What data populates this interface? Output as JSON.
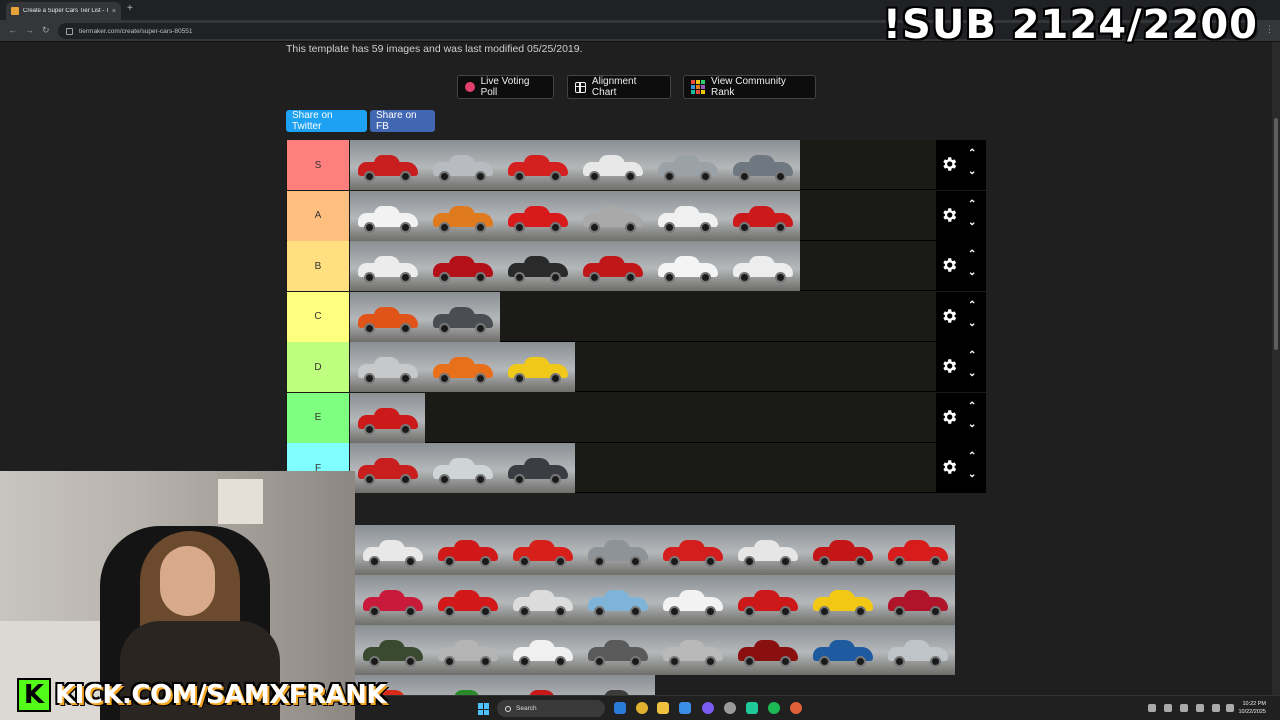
{
  "browser": {
    "tab_title": "Create a Super Cars Tier List - T",
    "tab_close": "×",
    "new_tab": "+",
    "url": "tiermaker.com/create/super-cars-80551"
  },
  "page": {
    "info_text": "This template has 59 images and was last modified 05/25/2019.",
    "buttons": {
      "live_poll": "Live Voting Poll",
      "alignment": "Alignment Chart",
      "community": "View Community Rank"
    },
    "share": {
      "twitter": "Share on Twitter",
      "facebook": "Share on FB"
    }
  },
  "tiers": [
    {
      "label": "S",
      "color": "#ff7f7f",
      "cars": [
        "#c81e1e",
        "#b8bcc0",
        "#d4201e",
        "#e8e8e8",
        "#9aa2a8",
        "#6f7780"
      ]
    },
    {
      "label": "A",
      "color": "#ffbf7f",
      "cars": [
        "#f2f2f2",
        "#e07a1f",
        "#d91a1a",
        "#a9a9a9",
        "#f0f0f0",
        "#cc1a1a"
      ]
    },
    {
      "label": "B",
      "color": "#ffdf7f",
      "cars": [
        "#ececec",
        "#b3101a",
        "#2a2a2a",
        "#c01818",
        "#f4f4f4",
        "#ededed"
      ]
    },
    {
      "label": "C",
      "color": "#ffff7f",
      "cars": [
        "#e0541a",
        "#4a4d52"
      ]
    },
    {
      "label": "D",
      "color": "#bfff7f",
      "cars": [
        "#c6c8ca",
        "#e8701a",
        "#f0c81a"
      ]
    },
    {
      "label": "E",
      "color": "#7fff7f",
      "cars": [
        "#cc1a1a"
      ]
    },
    {
      "label": "F",
      "color": "#7fffff",
      "cars": [
        "#c81e1e",
        "#cfd4d6",
        "#3a3d42"
      ]
    }
  ],
  "pool": [
    [
      "#e8e8e8",
      "#d01818",
      "#d8201a",
      "#8e9398",
      "#d41e1e",
      "#e6e6e6",
      "#c41616",
      "#d81c1c"
    ],
    [
      "#c81a3a",
      "#d21818",
      "#dcdcdc",
      "#7fb4d8",
      "#f2f2f2",
      "#cc1818",
      "#f2c814",
      "#b0142a"
    ],
    [
      "#3a4a30",
      "#b4b4b4",
      "#f0f0f0",
      "#5a5a5a",
      "#b9b9b9",
      "#8a1010",
      "#1e5aa0",
      "#bfc4c8"
    ],
    [
      "#d82a18",
      "#2a8a2a",
      "#c81818",
      "#3c3c3c"
    ]
  ],
  "taskbar": {
    "search_label": "Search",
    "time": "10:22 PM",
    "date": "10/22/2025"
  },
  "overlay": {
    "sub_counter": "!SUB 2124/2200",
    "kick_letter": "K",
    "kick_url": "KICK.COM/SAMXFRANK"
  }
}
